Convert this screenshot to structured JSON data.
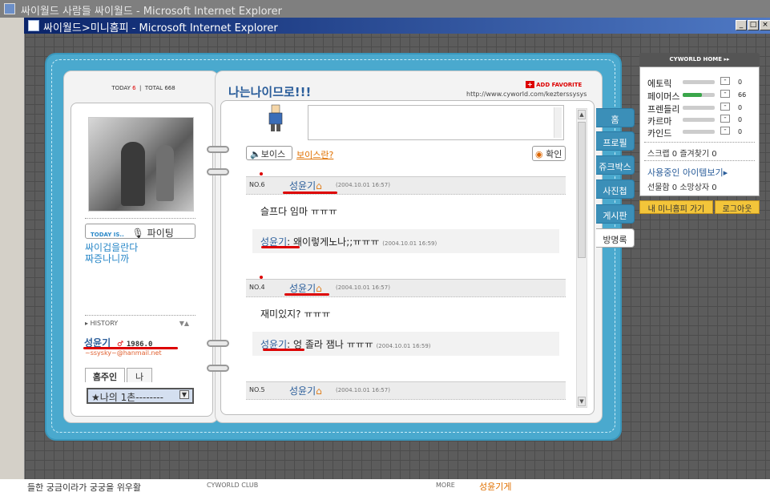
{
  "outer_window": {
    "title": "싸이월드 사람들 싸이월드 - Microsoft Internet Explorer"
  },
  "window": {
    "title": "싸이월드>미니홈피 - Microsoft Internet Explorer"
  },
  "profile": {
    "today_label": "TODAY",
    "today_value": "6",
    "total_label": "TOTAL",
    "total_value": "668",
    "today_is_label": "TODAY IS..",
    "mood": "파이팅",
    "message_line1": "싸이겁을란다",
    "message_line2": "짜증나니까",
    "history_label": "HISTORY",
    "owner_name": "성윤기",
    "owner_birth": "1986.0",
    "owner_email": "~ssysky~@hanmail.net",
    "tab_owner": "홈주인",
    "tab_me": "나",
    "ilchon_select": "★나의 1촌--------"
  },
  "header": {
    "title": "나는나이므로!!!",
    "add_favorite": "ADD FAVORITE",
    "url": "http://www.cyworld.com/kezterssysys"
  },
  "guestbook": {
    "voice_button": "보이스",
    "voice_link": "보이스란?",
    "confirm_button": "확인",
    "entries": [
      {
        "no": "NO.6",
        "name": "성윤기",
        "time": "(2004.10.01 16:57)",
        "text": "슬프다 임마 ㅠㅠㅠ",
        "reply_name": "성윤기",
        "reply_text": ": 왜이렇게노나;;ㅠㅠㅠ",
        "reply_time": "(2004.10.01 16:59)"
      },
      {
        "no": "NO.4",
        "name": "성윤기",
        "time": "(2004.10.01 16:57)",
        "text": "재미있지? ㅠㅠㅠ",
        "reply_name": "성윤기",
        "reply_text": ": 엉 졸라 잼나 ㅠㅠㅠ",
        "reply_time": "(2004.10.01 16:59)"
      },
      {
        "no": "NO.5",
        "name": "성윤기",
        "time": "(2004.10.01 16:57)"
      }
    ]
  },
  "nav_tabs": [
    "홈",
    "프로필",
    "쥬크박스",
    "사진첩",
    "게시판",
    "방명록"
  ],
  "cyworld_home": {
    "title": "CYWORLD HOME",
    "stats": [
      {
        "label": "에토릭",
        "value": "0",
        "fill": 0.0
      },
      {
        "label": "페이머스",
        "value": "66",
        "fill": 0.6
      },
      {
        "label": "프렌들리",
        "value": "0",
        "fill": 0.0
      },
      {
        "label": "카르마",
        "value": "0",
        "fill": 0.0
      },
      {
        "label": "카인드",
        "value": "0",
        "fill": 0.0
      }
    ],
    "scrap": "스크랩 0 즐겨찾기 0",
    "items_link": "사용중인 아이템보기",
    "gift": "선물함 0 소망상자 0",
    "my_minihome": "내 미니홈피 가기",
    "logout": "로그아웃"
  },
  "bottom_strip": {
    "text_left": "들한 궁금이라가 궁궁을 위우활",
    "club": "CYWORLD CLUB",
    "more": "MORE",
    "right": "성윤기게"
  }
}
